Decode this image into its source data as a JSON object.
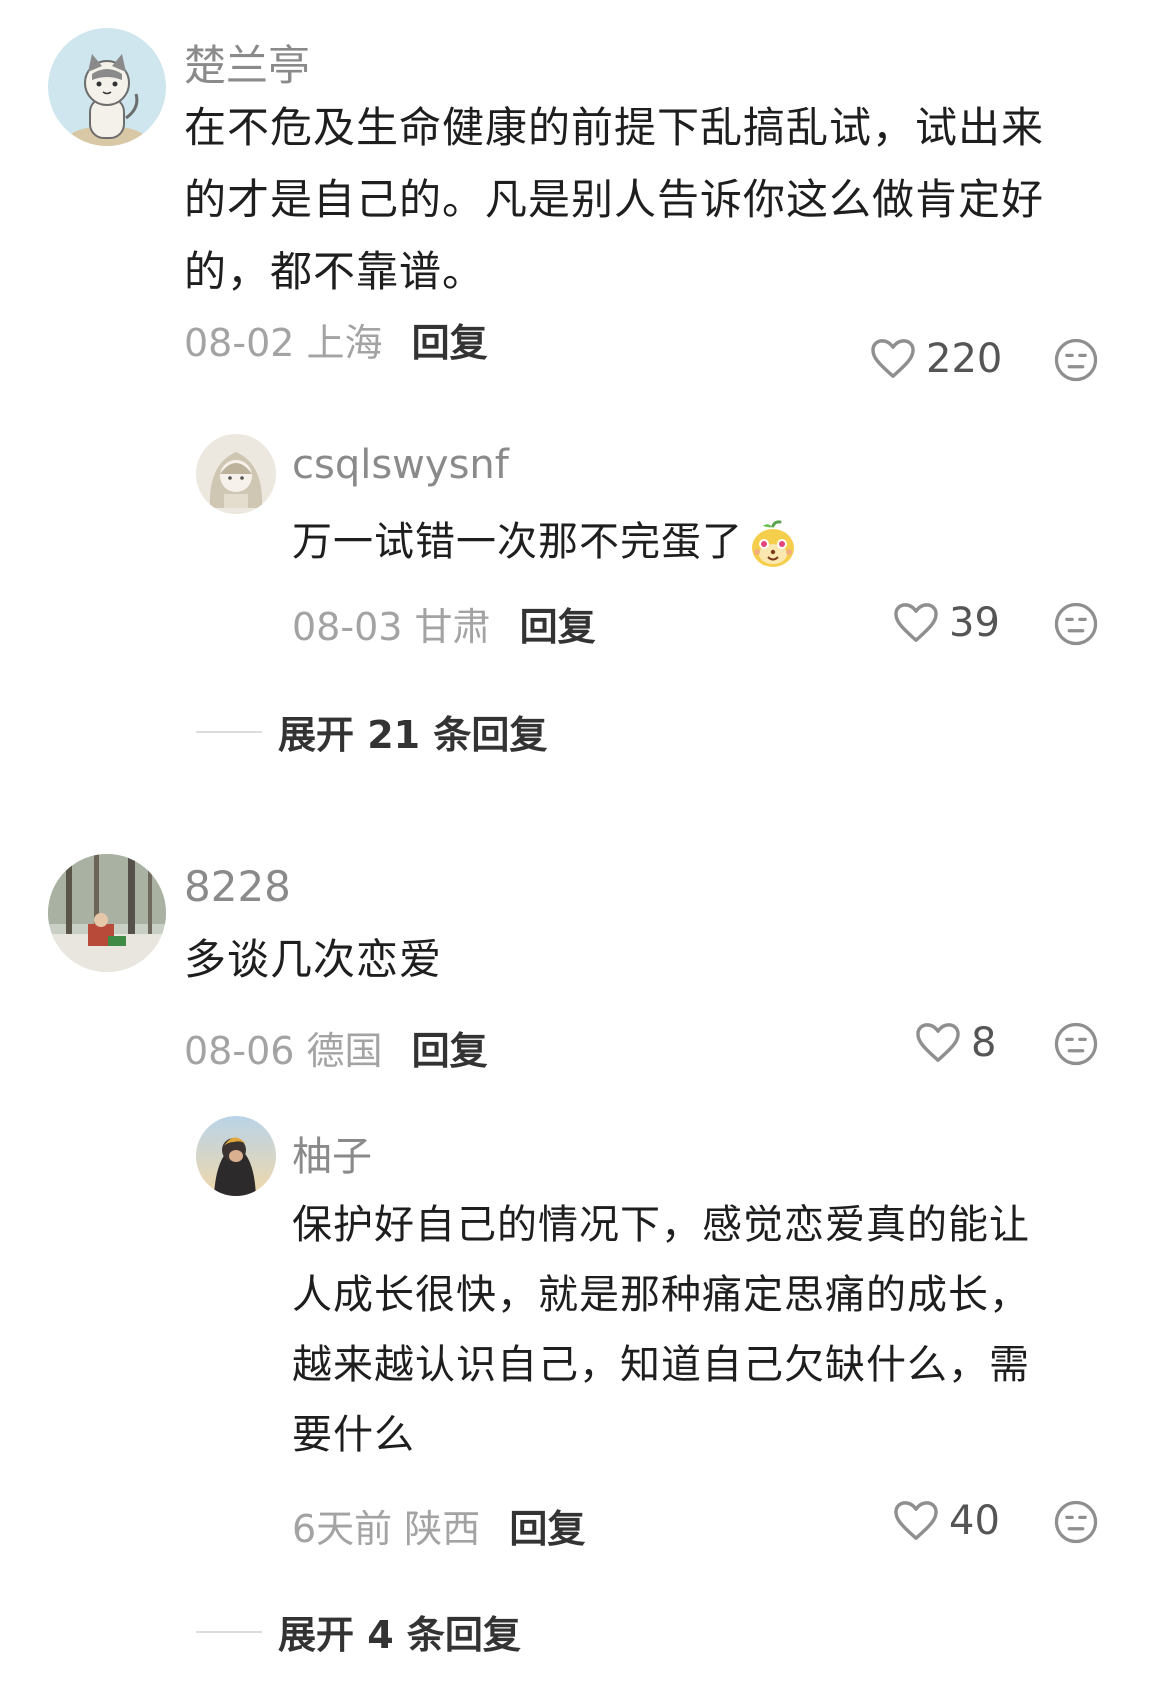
{
  "comments": [
    {
      "username": "楚兰亭",
      "content_lines": [
        "在不危及生命健康的前提下乱搞乱试，试出来",
        "的才是自己的。凡是别人告诉你这么做肯定好",
        "的，都不靠谱。"
      ],
      "date": "08-02 上海",
      "reply_label": "回复",
      "likes": "220",
      "avatar_icon": "cartoon-cat-avatar",
      "replies": [
        {
          "username": "csqlswysnf",
          "content": "万一试错一次那不完蛋了",
          "emoji": "smiling-mango-emoji",
          "date": "08-03 甘肃",
          "reply_label": "回复",
          "likes": "39",
          "avatar_icon": "anime-girl-avatar"
        }
      ],
      "expand_label": "展开 21 条回复"
    },
    {
      "username": "8228",
      "content_lines": [
        "多谈几次恋爱"
      ],
      "date": "08-06 德国",
      "reply_label": "回复",
      "likes": "8",
      "avatar_icon": "forest-scene-avatar",
      "replies": [
        {
          "username": "柚子",
          "content_lines": [
            "保护好自己的情况下，感觉恋爱真的能让",
            "人成长很快，就是那种痛定思痛的成长，",
            "越来越认识自己，知道自己欠缺什么，需",
            "要什么"
          ],
          "date": "6天前 陕西",
          "reply_label": "回复",
          "likes": "40",
          "avatar_icon": "sunset-portrait-avatar"
        }
      ],
      "expand_label": "展开 4 条回复"
    }
  ],
  "colors": {
    "username": "#8a8a8a",
    "meta": "#a3a3a3",
    "text": "#1e1e1e",
    "icon": "#8f8f8f"
  }
}
